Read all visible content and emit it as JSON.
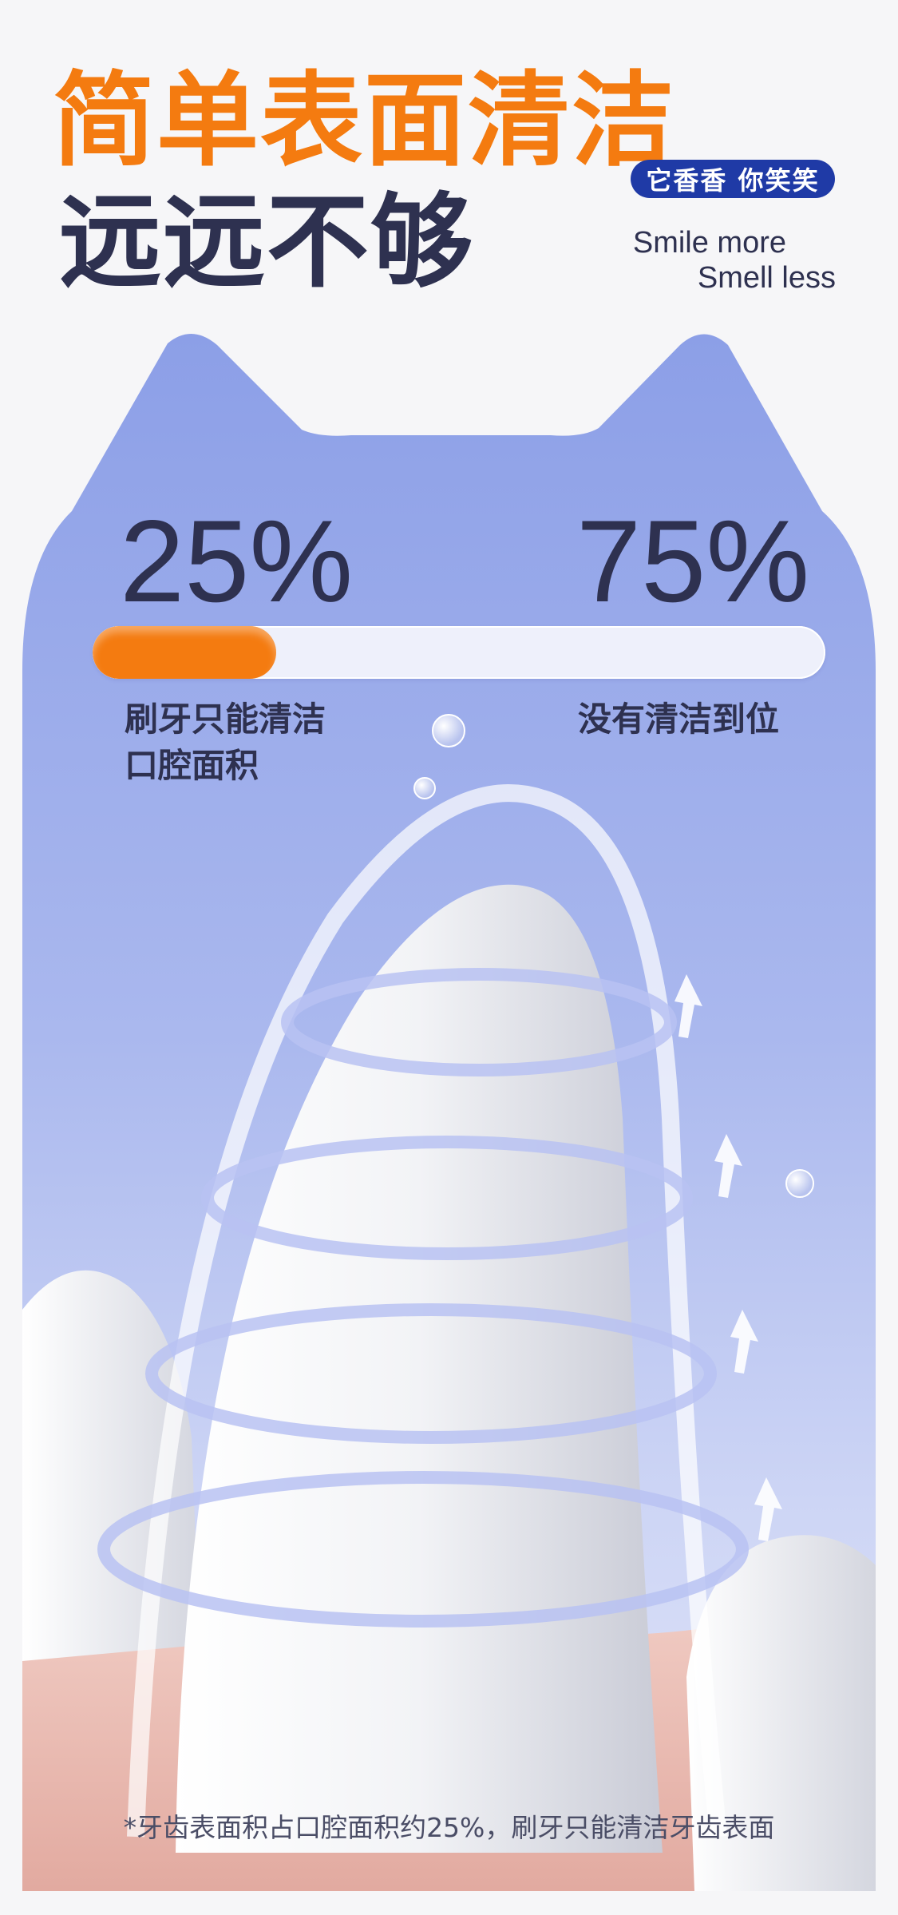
{
  "header": {
    "headline_line1": "简单表面清洁",
    "headline_line2": "远远不够",
    "brand_badge": "它香香 你笑笑",
    "slogan_line1": "Smile more",
    "slogan_line2": "Smell less"
  },
  "stats": {
    "left_value": "25%",
    "right_value": "75%",
    "left_caption_line1": "刷牙只能清洁",
    "left_caption_line2": "口腔面积",
    "right_caption": "没有清洁到位",
    "cleaned_fraction": 0.25
  },
  "footnote": "*牙齿表面积占口腔面积约25%，刷牙只能清洁牙齿表面",
  "icons": [
    "tooth-illustration-icon",
    "swirl-arrows-icon",
    "water-drop-icon",
    "cat-ears-panel"
  ],
  "colors": {
    "orange": "#f47b10",
    "navy": "#2e3150",
    "badge_blue": "#1f3aa6",
    "panel_top": "#8ea1e8",
    "panel_bottom": "#d4dbf6",
    "gum_pink": "#ecc2bb"
  }
}
